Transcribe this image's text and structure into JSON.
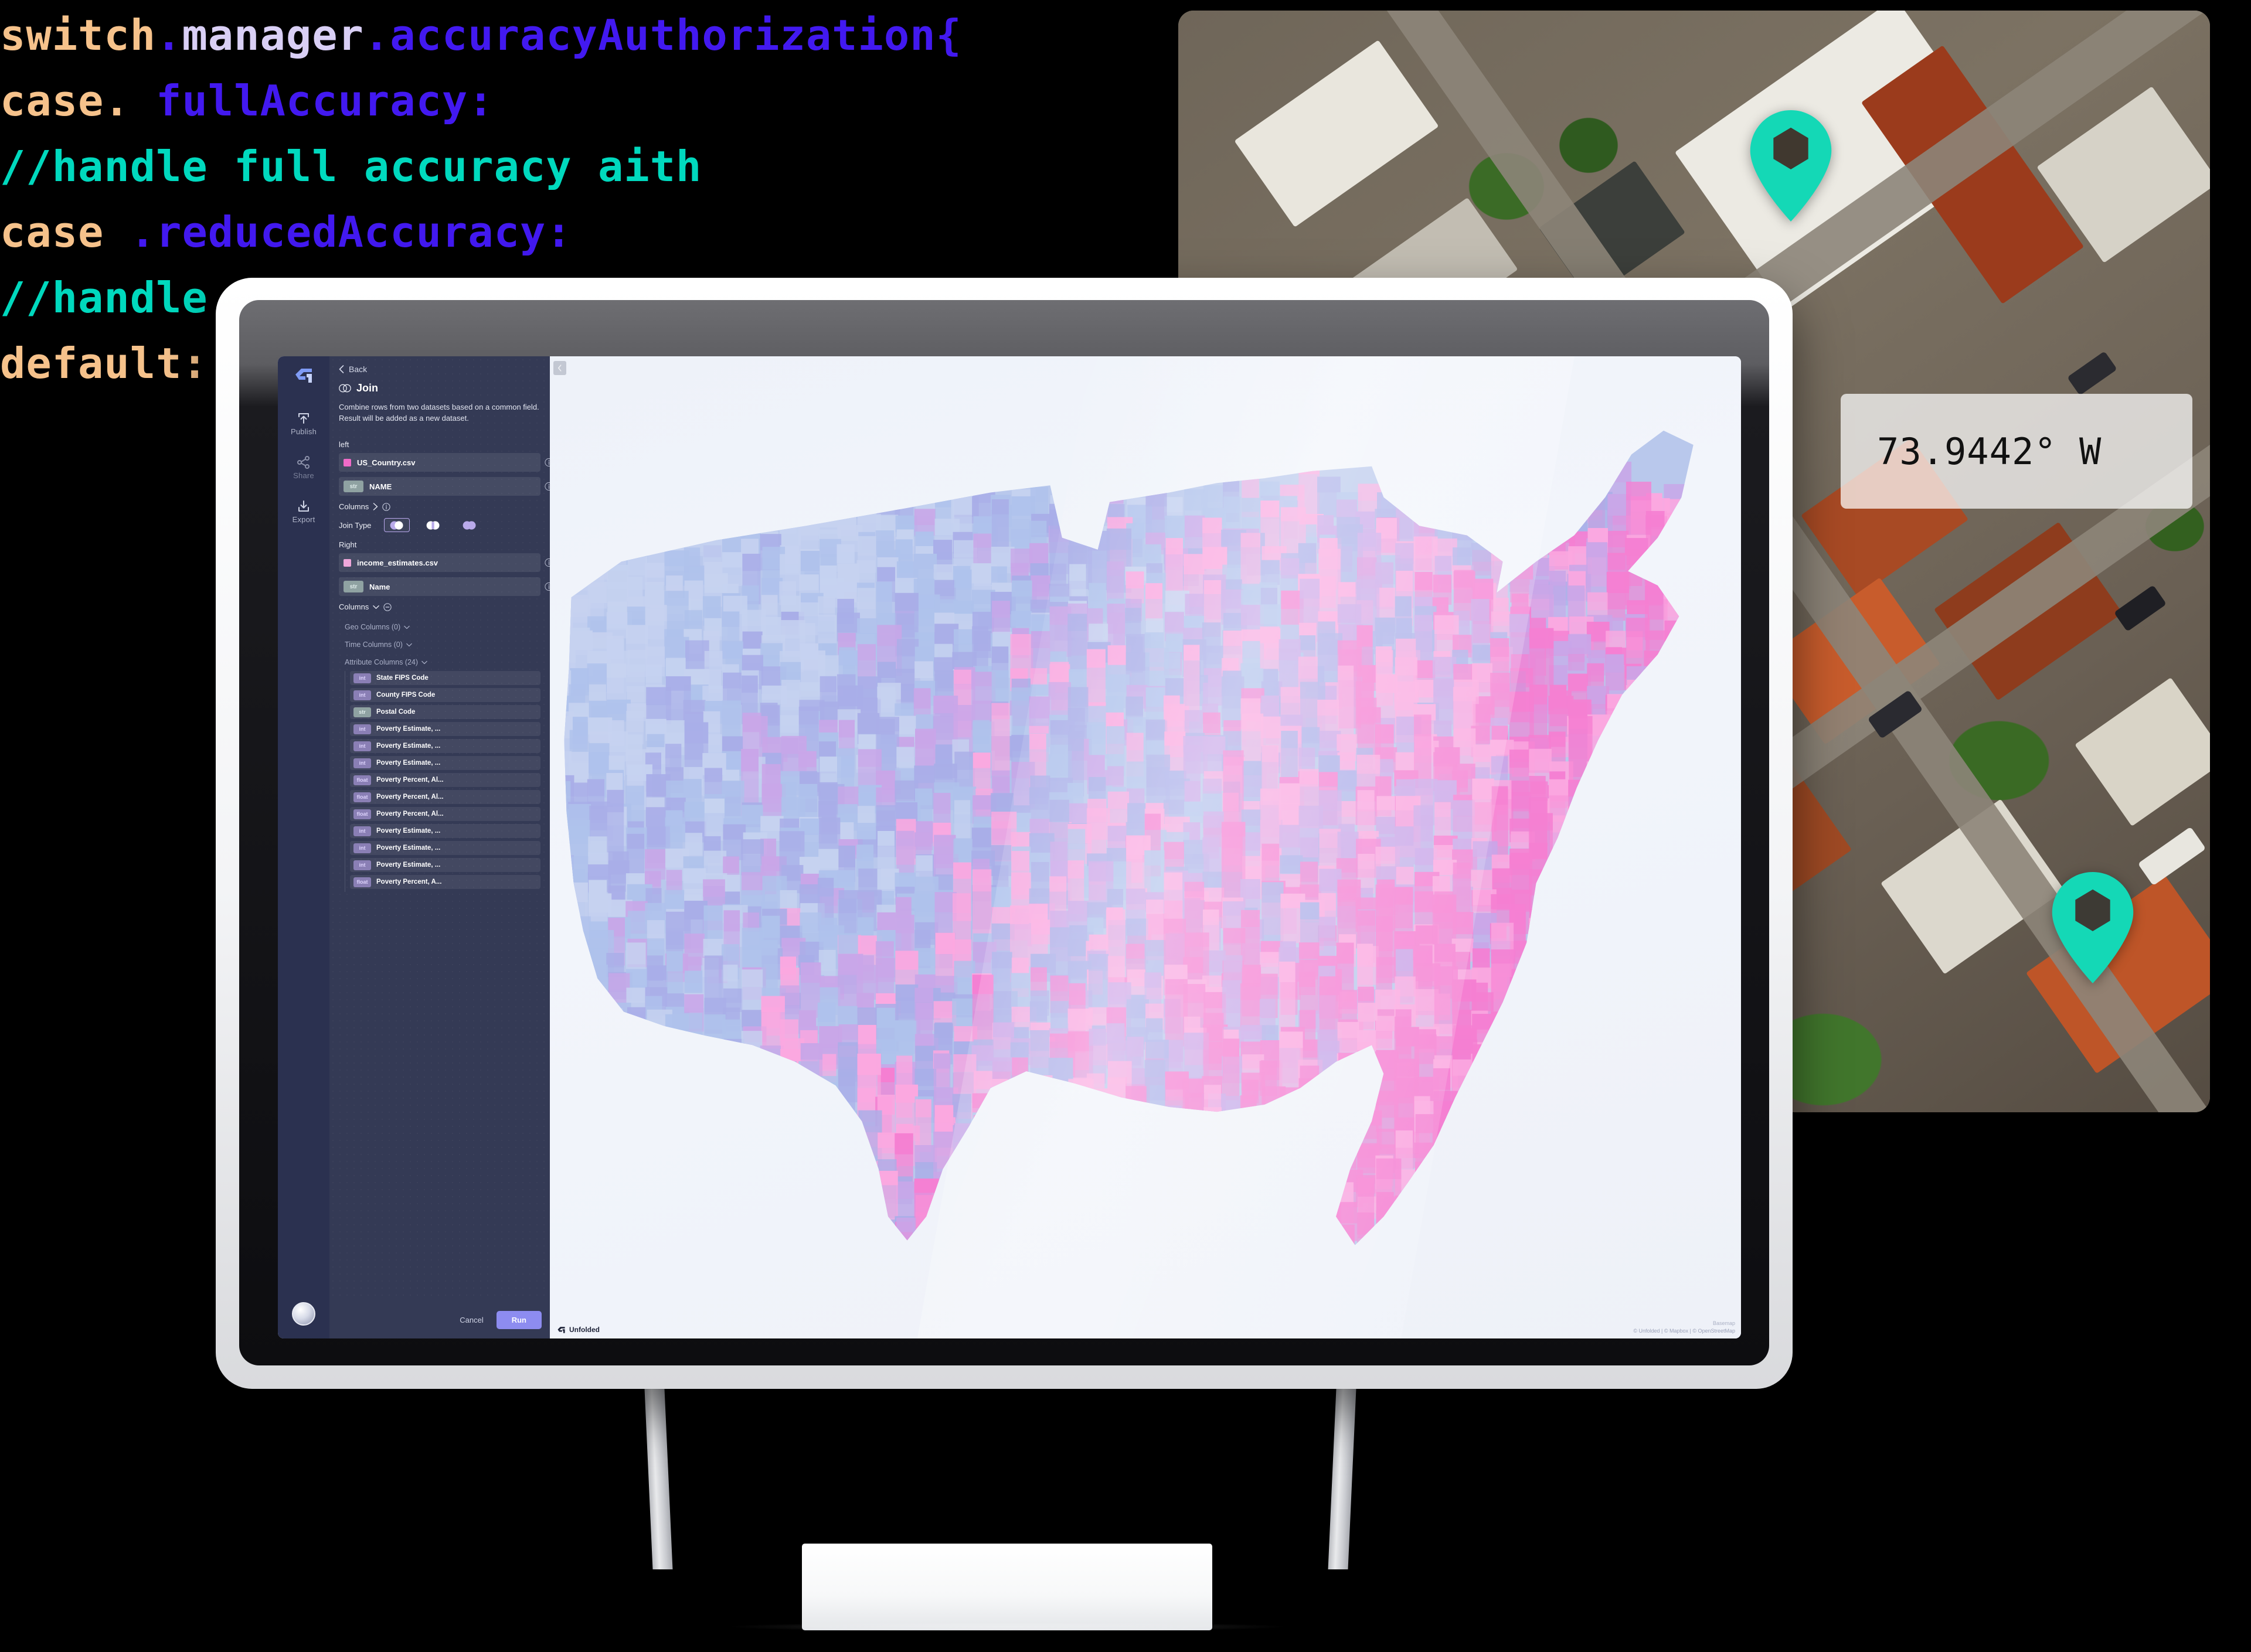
{
  "code_snippet": {
    "lines": [
      [
        {
          "t": "switch",
          "c": "key"
        },
        {
          "t": ".",
          "c": "pnc"
        },
        {
          "t": "manager",
          "c": "prop"
        },
        {
          "t": ".",
          "c": "pnc"
        },
        {
          "t": "accuracyAuthorization{",
          "c": "fn"
        }
      ],
      [
        {
          "t": "case. ",
          "c": "key"
        },
        {
          "t": "fullAccuracy:",
          "c": "fn"
        }
      ],
      [
        {
          "t": "//handle full accuracy aith",
          "c": "com"
        }
      ],
      [
        {
          "t": "case ",
          "c": "key"
        },
        {
          "t": ".reducedAccuracy:",
          "c": "fn"
        }
      ],
      [
        {
          "t": "//handle",
          "c": "com"
        }
      ],
      [
        {
          "t": "default:",
          "c": "key"
        }
      ]
    ],
    "colors": {
      "keyword": "#F6C28B",
      "property": "#D9CFF5",
      "function": "#4219F0",
      "comment": "#00D9BE"
    }
  },
  "aerial_card": {
    "name": "aerial-satellite-photo",
    "pins": [
      {
        "label": "map-pin-top"
      },
      {
        "label": "map-pin-bottom"
      }
    ],
    "pin_color": "#14D8B6",
    "coordinate_chip": {
      "value": "73.9442° W"
    }
  },
  "app": {
    "rail": {
      "logo_name": "unfolded-logo",
      "items": [
        {
          "label": "Publish",
          "icon": "upload-icon"
        },
        {
          "label": "Share",
          "icon": "share-icon"
        },
        {
          "label": "Export",
          "icon": "download-icon"
        }
      ],
      "avatar_name": "user-avatar"
    },
    "panel": {
      "back_label": "Back",
      "title": "Join",
      "title_icon": "join-venn-icon",
      "description": "Combine rows from two datasets based on a common field. Result will be added as a new dataset.",
      "left": {
        "section_label": "left",
        "dataset": "US_Country.csv",
        "dataset_swatch": "#F06BC8",
        "join_field_type": "str",
        "join_field": "NAME",
        "columns_label": "Columns",
        "columns_state": "collapsed"
      },
      "join_type": {
        "label": "Join Type",
        "options": [
          "right-join",
          "inner-join",
          "full-outer-join"
        ],
        "selected_index": 0
      },
      "right": {
        "section_label": "Right",
        "dataset": "income_estimates.csv",
        "dataset_swatch": "#EFA7DA",
        "join_field_type": "str",
        "join_field": "Name",
        "columns_label": "Columns",
        "columns_state": "expanded",
        "groups": [
          {
            "label": "Geo Columns (0)"
          },
          {
            "label": "Time Columns (0)"
          },
          {
            "label": "Attribute Columns (24)"
          }
        ],
        "columns": [
          {
            "type": "int",
            "name": "State FIPS Code",
            "checked": true
          },
          {
            "type": "int",
            "name": "County FIPS Code",
            "checked": true
          },
          {
            "type": "str",
            "name": "Postal Code",
            "checked": true
          },
          {
            "type": "int",
            "name": "Poverty Estimate, ...",
            "checked": true
          },
          {
            "type": "int",
            "name": "Poverty Estimate, ...",
            "checked": true
          },
          {
            "type": "int",
            "name": "Poverty Estimate, ...",
            "checked": true
          },
          {
            "type": "float",
            "name": "Poverty Percent, Al...",
            "checked": true
          },
          {
            "type": "float",
            "name": "Poverty Percent, Al...",
            "checked": true
          },
          {
            "type": "float",
            "name": "Poverty Percent, Al...",
            "checked": true
          },
          {
            "type": "int",
            "name": "Poverty Estimate, ...",
            "checked": true
          },
          {
            "type": "int",
            "name": "Poverty Estimate, ...",
            "checked": true
          },
          {
            "type": "int",
            "name": "Poverty Estimate, ...",
            "checked": true
          },
          {
            "type": "float",
            "name": "Poverty Percent, A...",
            "checked": true
          }
        ]
      },
      "actions": {
        "cancel_label": "Cancel",
        "run_label": "Run",
        "run_color": "#8D8CF0"
      }
    },
    "map": {
      "collapse_icon": "chevron-left-icon",
      "brand_label": "Unfolded",
      "brand_icon": "unfolded-logo",
      "basemap_label": "Basemap",
      "attribution": "© Unfolded | © Mapbox | © OpenStreetMap",
      "visualization": "3D extruded county choropleth of the contiguous United States",
      "palette": [
        "#F57FD2",
        "#FBA8E0",
        "#C9A6E8",
        "#A9AEE8",
        "#AFC2EC",
        "#C6D2F0"
      ],
      "background_color": "#EEF1F8"
    }
  }
}
